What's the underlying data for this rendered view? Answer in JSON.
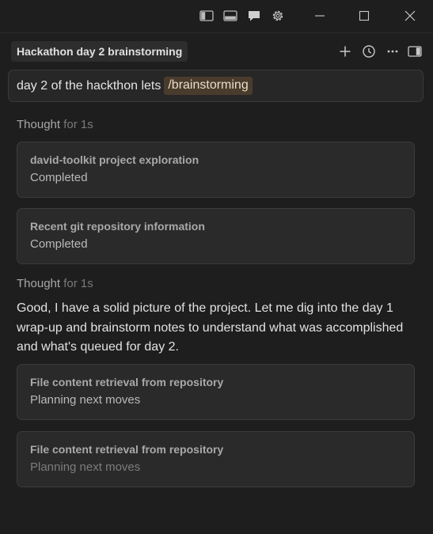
{
  "titlebar": {
    "icons": [
      "sidebar-left-icon",
      "panel-bottom-icon",
      "chat-icon",
      "gear-icon",
      "minimize-icon",
      "maximize-icon",
      "close-icon"
    ]
  },
  "header": {
    "title": "Hackathon day 2 brainstorming",
    "icons": [
      "plus-icon",
      "history-icon",
      "more-icon",
      "sidebar-right-icon"
    ]
  },
  "prompt": {
    "text": "day 2 of the hackthon lets",
    "command": "/brainstorming"
  },
  "thoughts": [
    {
      "label": "Thought",
      "duration": "for 1s"
    },
    {
      "label": "Thought",
      "duration": "for 1s"
    }
  ],
  "cards": [
    {
      "title": "david-toolkit project exploration",
      "status": "Completed"
    },
    {
      "title": "Recent git repository information",
      "status": "Completed"
    },
    {
      "title": "File content retrieval from repository",
      "status": "Planning next moves"
    },
    {
      "title": "File content retrieval from repository",
      "status": "Planning next moves"
    }
  ],
  "message": "Good, I have a solid picture of the project. Let me dig into the day 1 wrap-up and brainstorm notes to understand what was accomplished and what's queued for day 2.",
  "colors": {
    "background": "#1e1e1e",
    "card": "#2a2a2a",
    "chip": "#4a3c2c"
  }
}
